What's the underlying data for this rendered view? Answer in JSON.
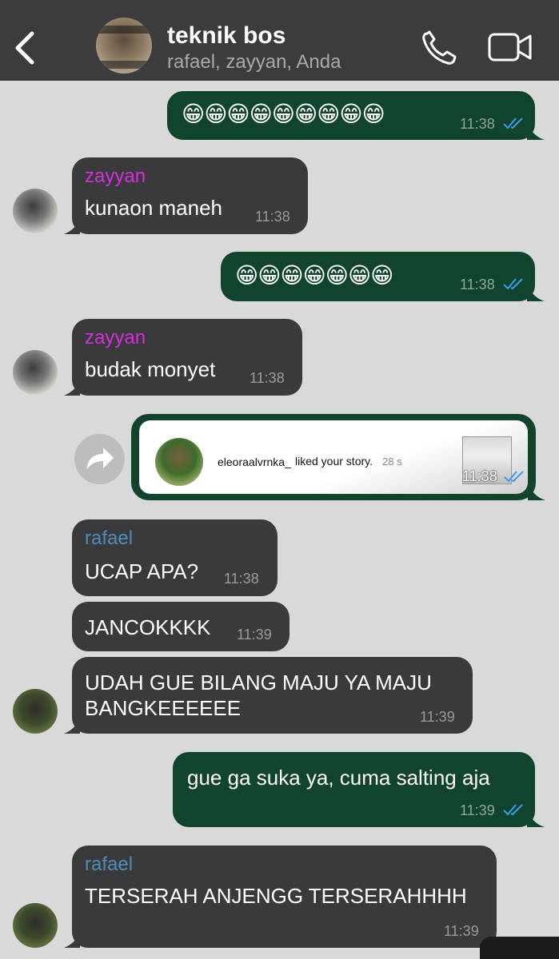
{
  "header": {
    "title": "teknik bos",
    "subtitle": "rafael, zayyan, Anda",
    "back_icon": "chevron-left-icon",
    "call_icon": "phone-icon",
    "video_icon": "video-camera-icon"
  },
  "messages": [
    {
      "direction": "out",
      "text": "😁😁😁😁😁😁😁😁😁",
      "time": "11:38",
      "status": "read"
    },
    {
      "direction": "in",
      "sender": "zayyan",
      "text": "kunaon maneh",
      "time": "11:38"
    },
    {
      "direction": "out",
      "text": "😁😁😁😁😁😁😁",
      "time": "11:38",
      "status": "read"
    },
    {
      "direction": "in",
      "sender": "zayyan",
      "text": "budak monyet",
      "time": "11:38"
    },
    {
      "direction": "out",
      "type": "shared-story",
      "story_user": "eleoraalvrnka_",
      "story_text": "liked your story.",
      "story_ago": "28 s",
      "time": "11:38",
      "status": "read"
    },
    {
      "direction": "in",
      "sender": "rafael",
      "text": "UCAP APA?",
      "time": "11:38"
    },
    {
      "direction": "in",
      "text": "JANCOKKKK",
      "time": "11:39"
    },
    {
      "direction": "in",
      "text": "UDAH GUE BILANG MAJU YA MAJU BANGKEEEEEE",
      "time": "11:39"
    },
    {
      "direction": "out",
      "text": "gue ga suka ya, cuma salting aja",
      "time": "11:39",
      "status": "read"
    },
    {
      "direction": "in",
      "sender": "rafael",
      "text": "TERSERAH ANJENGG TERSERAHHHH",
      "time": "11:39"
    }
  ],
  "colors": {
    "zayyan_name": "#d52ede",
    "rafael_name": "#4a8fb8",
    "read_tick": "#3b9bf0",
    "outgoing_bubble": "#10442d",
    "incoming_bubble": "#3a3a3c"
  }
}
